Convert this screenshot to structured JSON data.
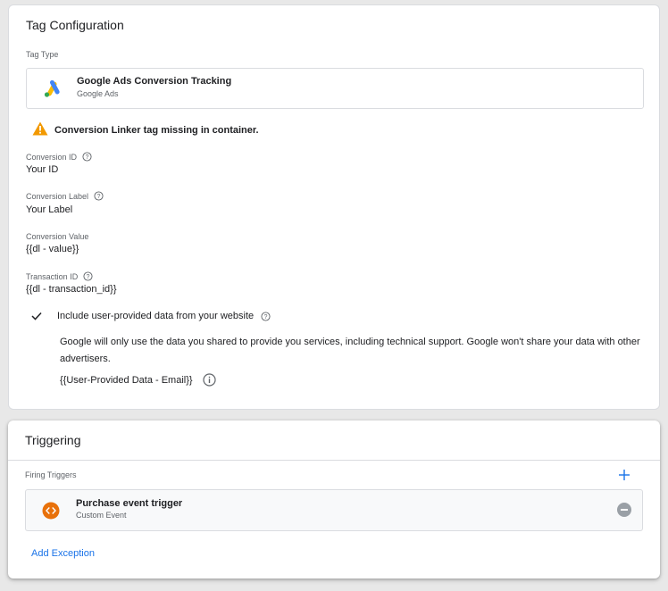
{
  "tag_config": {
    "title": "Tag Configuration",
    "tag_type_label": "Tag Type",
    "tag_type": {
      "name": "Google Ads Conversion Tracking",
      "sub": "Google Ads",
      "icon": "google-ads-logo"
    },
    "warning": "Conversion Linker tag missing in container.",
    "fields": {
      "conversion_id": {
        "label": "Conversion ID",
        "value": "Your ID"
      },
      "conversion_label": {
        "label": "Conversion Label",
        "value": "Your Label"
      },
      "conversion_value": {
        "label": "Conversion Value",
        "value": "{{dl - value}}"
      },
      "transaction_id": {
        "label": "Transaction ID",
        "value": "{{dl - transaction_id}}"
      }
    },
    "user_data": {
      "checkbox_label": "Include user-provided data from your website",
      "checked": true,
      "description": "Google will only use the data you shared to provide you services, including technical support. Google won't share your data with other advertisers.",
      "variable": "{{User-Provided Data - Email}}"
    }
  },
  "triggering": {
    "title": "Triggering",
    "firing_label": "Firing Triggers",
    "trigger": {
      "name": "Purchase event trigger",
      "sub": "Custom Event",
      "icon": "custom-event-icon"
    },
    "add_exception": "Add Exception"
  },
  "colors": {
    "accent": "#1a73e8",
    "warning": "#f29900",
    "trigger_icon": "#e8710a"
  }
}
